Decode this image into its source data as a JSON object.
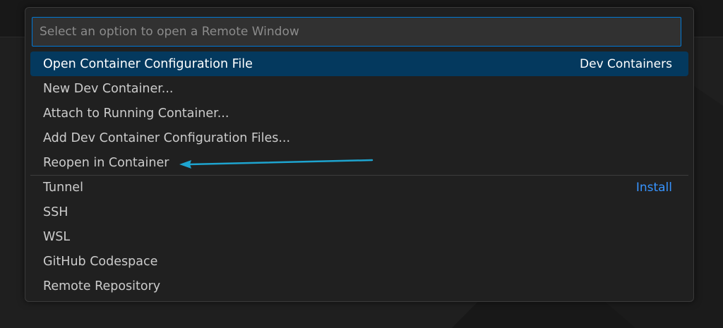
{
  "quick_pick": {
    "placeholder": "Select an option to open a Remote Window",
    "value": "",
    "items": [
      {
        "label": "Open Container Configuration File",
        "description": "Dev Containers",
        "focused": true
      },
      {
        "label": "New Dev Container..."
      },
      {
        "label": "Attach to Running Container..."
      },
      {
        "label": "Add Dev Container Configuration Files..."
      },
      {
        "label": "Reopen in Container"
      },
      {
        "label": "Tunnel",
        "action": "Install"
      },
      {
        "label": "SSH"
      },
      {
        "label": "WSL"
      },
      {
        "label": "GitHub Codespace"
      },
      {
        "label": "Remote Repository"
      }
    ]
  },
  "colors": {
    "accent": "#0078d4",
    "selection": "#04395e",
    "link": "#3794ff",
    "annotation_arrow": "#1ea4cf"
  },
  "icons": {
    "annotation": "arrow-left-icon",
    "background": "vscode-logo-watermark"
  }
}
